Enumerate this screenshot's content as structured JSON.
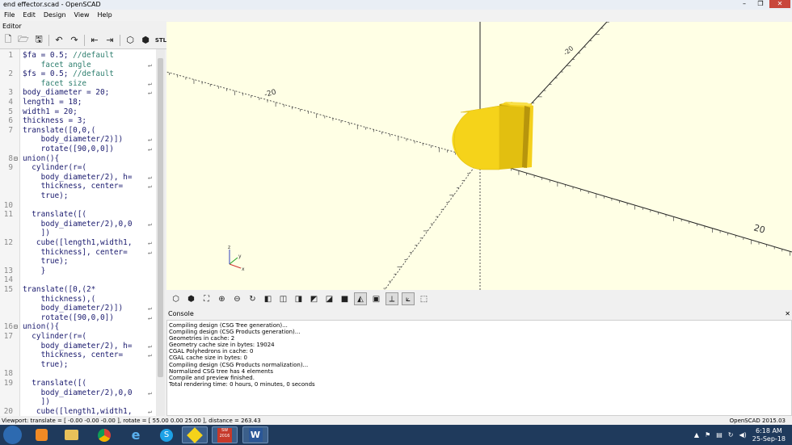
{
  "window": {
    "title": "end effector.scad - OpenSCAD",
    "blurred_tabs": [
      "",
      ""
    ]
  },
  "menu": {
    "items": [
      "File",
      "Edit",
      "Design",
      "View",
      "Help"
    ]
  },
  "editor": {
    "label": "Editor",
    "toolbar": [
      "new-icon",
      "open-icon",
      "save-icon",
      "undo-icon",
      "redo-icon",
      "unindent-icon",
      "indent-icon",
      "preview-icon",
      "render-icon",
      "export-stl-icon"
    ],
    "lines": [
      {
        "n": "1",
        "t": "$fa = 0.5; ",
        "c": "//default"
      },
      {
        "n": "",
        "t": "",
        "c": "    facet angle"
      },
      {
        "n": "2",
        "t": "$fs = 0.5; ",
        "c": "//default"
      },
      {
        "n": "",
        "t": "",
        "c": "    facet size"
      },
      {
        "n": "3",
        "t": "body_diameter = 20;",
        "c": ""
      },
      {
        "n": "4",
        "t": "length1 = 18;",
        "c": ""
      },
      {
        "n": "5",
        "t": "width1 = 20;",
        "c": ""
      },
      {
        "n": "6",
        "t": "thickness = 3;",
        "c": ""
      },
      {
        "n": "7",
        "t": "translate([0,0,(",
        "c": ""
      },
      {
        "n": "",
        "t": "    body_diameter/2)])",
        "c": ""
      },
      {
        "n": "",
        "t": "    rotate([90,0,0])",
        "c": ""
      },
      {
        "n": "8",
        "t": "union(){",
        "c": "",
        "fold": true
      },
      {
        "n": "9",
        "t": "  cylinder(r=(",
        "c": ""
      },
      {
        "n": "",
        "t": "    body_diameter/2), h=",
        "c": ""
      },
      {
        "n": "",
        "t": "    thickness, center=",
        "c": ""
      },
      {
        "n": "",
        "t": "    true);",
        "c": ""
      },
      {
        "n": "10",
        "t": "",
        "c": ""
      },
      {
        "n": "11",
        "t": "  translate([(",
        "c": ""
      },
      {
        "n": "",
        "t": "    body_diameter/2),0,0",
        "c": ""
      },
      {
        "n": "",
        "t": "    ])",
        "c": ""
      },
      {
        "n": "12",
        "t": "   cube([length1,width1,",
        "c": ""
      },
      {
        "n": "",
        "t": "    thickness], center=",
        "c": ""
      },
      {
        "n": "",
        "t": "    true);",
        "c": ""
      },
      {
        "n": "13",
        "t": "    }",
        "c": ""
      },
      {
        "n": "14",
        "t": "",
        "c": ""
      },
      {
        "n": "15",
        "t": "translate([0,(2*",
        "c": ""
      },
      {
        "n": "",
        "t": "    thickness),(",
        "c": ""
      },
      {
        "n": "",
        "t": "    body_diameter/2)])",
        "c": ""
      },
      {
        "n": "",
        "t": "    rotate([90,0,0])",
        "c": ""
      },
      {
        "n": "16",
        "t": "union(){",
        "c": "",
        "fold": true
      },
      {
        "n": "17",
        "t": "  cylinder(r=(",
        "c": ""
      },
      {
        "n": "",
        "t": "    body_diameter/2), h=",
        "c": ""
      },
      {
        "n": "",
        "t": "    thickness, center=",
        "c": ""
      },
      {
        "n": "",
        "t": "    true);",
        "c": ""
      },
      {
        "n": "18",
        "t": "",
        "c": ""
      },
      {
        "n": "19",
        "t": "  translate([(",
        "c": ""
      },
      {
        "n": "",
        "t": "    body_diameter/2),0,0",
        "c": ""
      },
      {
        "n": "",
        "t": "    ])",
        "c": ""
      },
      {
        "n": "20",
        "t": "   cube([length1,width1,",
        "c": ""
      }
    ]
  },
  "viewport": {
    "background": "#ffffe5",
    "model_color": "#f5d31a",
    "axis_labels": [
      "-20",
      "20",
      "-20"
    ],
    "toolbar": [
      "view-all-icon",
      "reset-view-icon",
      "zoom-fit-icon",
      "zoom-in-icon",
      "zoom-out-icon",
      "rotate-icon",
      "view-right-icon",
      "view-top-icon",
      "view-bottom-icon",
      "view-left-icon",
      "view-front-icon",
      "view-back-icon",
      "perspective-icon",
      "orthogonal-icon",
      "show-axes-icon",
      "show-scale-icon",
      "show-edges-icon"
    ],
    "active_toolbar": [
      "perspective-icon",
      "show-axes-icon",
      "show-scale-icon"
    ]
  },
  "console": {
    "label": "Console",
    "close": "✕",
    "lines": [
      "Compiling design (CSG Tree generation)...",
      "Compiling design (CSG Products generation)...",
      "Geometries in cache: 2",
      "Geometry cache size in bytes: 19024",
      "CGAL Polyhedrons in cache: 0",
      "CGAL cache size in bytes: 0",
      "Compiling design (CSG Products normalization)...",
      "Normalized CSG tree has 4 elements",
      "Compile and preview finished.",
      "Total rendering time: 0 hours, 0 minutes, 0 seconds"
    ]
  },
  "status": {
    "viewport": "Viewport: translate = [ -0.00 -0.00 -0.00 ], rotate = [ 55.00 0.00 25.00 ], distance = 263.43",
    "version": "OpenSCAD 2015.03"
  },
  "taskbar": {
    "apps": [
      "ie-icon",
      "media-player-icon",
      "explorer-icon",
      "chrome-icon",
      "internet-explorer-icon",
      "skype-icon",
      "openscad-icon",
      "solidworks-icon",
      "word-icon"
    ],
    "open_apps": [
      "openscad-icon",
      "solidworks-icon",
      "word-icon"
    ],
    "solidworks_label": "2016",
    "tray": [
      "chevron-up-icon",
      "flag-icon",
      "network-icon",
      "sync-icon",
      "speaker-icon"
    ],
    "time": "6:18 AM",
    "date": "25-Sep-18"
  }
}
